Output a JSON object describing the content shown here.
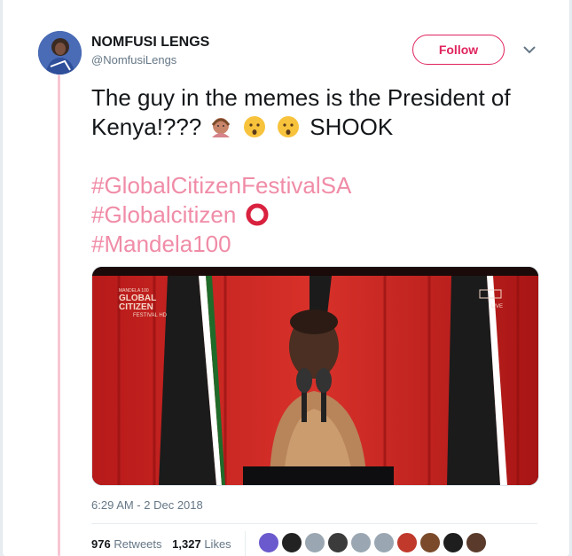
{
  "author": {
    "name": "NOMFUSI LENGS",
    "handle": "@NomfusiLengs"
  },
  "follow_label": "Follow",
  "tweet": {
    "line1": "The guy in the memes is the President of",
    "line2_text": "Kenya!???",
    "line2_emojis": [
      "woman-gesturing-ok-emoji",
      "hushed-face-emoji",
      "hushed-face-emoji"
    ],
    "line2_suffix": "SHOOK",
    "hashtags": [
      "#GlobalCitizenFestivalSA",
      "#Globalcitizen",
      "#Mandela100"
    ]
  },
  "media": {
    "broadcast_logo_line1": "MANDELA 100",
    "broadcast_logo_line2": "GLOBAL",
    "broadcast_logo_line3": "CITIZEN",
    "broadcast_logo_line4": "FESTIVAL HD",
    "live_badge": "LIVE"
  },
  "timestamp": "6:29 AM - 2 Dec 2018",
  "stats": {
    "retweets_count": "976",
    "retweets_label": "Retweets",
    "likes_count": "1,327",
    "likes_label": "Likes"
  },
  "colors": {
    "accent": "#e0245e",
    "hashtag": "#f08ca7",
    "thread_line": "#f7c6d3"
  },
  "likers": [
    "#6a5acd",
    "#222222",
    "#9aa7b2",
    "#3b3b3b",
    "#9aa7b2",
    "#9aa7b2",
    "#c0392b",
    "#7a4a2a",
    "#1e1e1e",
    "#5a3a2a"
  ]
}
